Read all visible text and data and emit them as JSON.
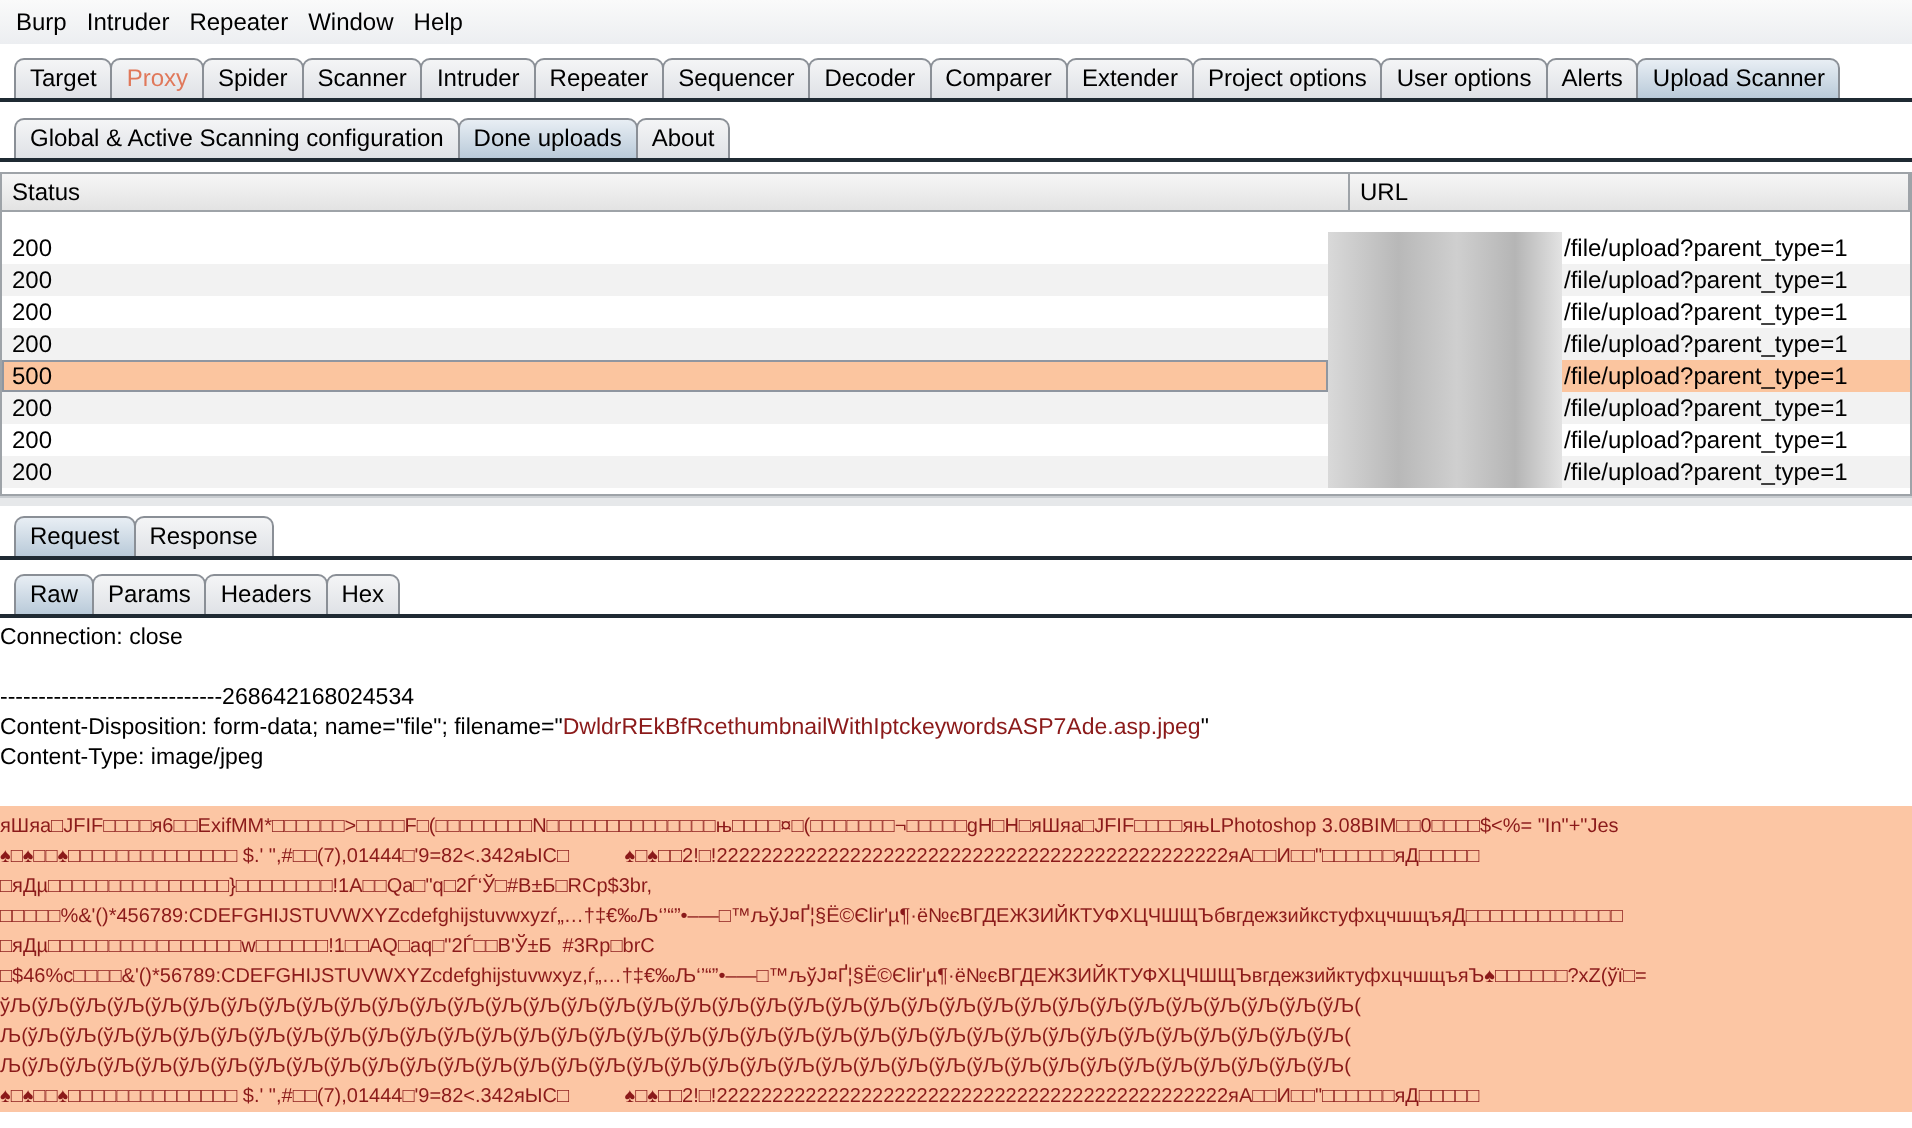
{
  "menu": [
    "Burp",
    "Intruder",
    "Repeater",
    "Window",
    "Help"
  ],
  "main_tabs": [
    {
      "label": "Target",
      "selected": false,
      "highlighted": false
    },
    {
      "label": "Proxy",
      "selected": false,
      "highlighted": true
    },
    {
      "label": "Spider",
      "selected": false,
      "highlighted": false
    },
    {
      "label": "Scanner",
      "selected": false,
      "highlighted": false
    },
    {
      "label": "Intruder",
      "selected": false,
      "highlighted": false
    },
    {
      "label": "Repeater",
      "selected": false,
      "highlighted": false
    },
    {
      "label": "Sequencer",
      "selected": false,
      "highlighted": false
    },
    {
      "label": "Decoder",
      "selected": false,
      "highlighted": false
    },
    {
      "label": "Comparer",
      "selected": false,
      "highlighted": false
    },
    {
      "label": "Extender",
      "selected": false,
      "highlighted": false
    },
    {
      "label": "Project options",
      "selected": false,
      "highlighted": false
    },
    {
      "label": "User options",
      "selected": false,
      "highlighted": false
    },
    {
      "label": "Alerts",
      "selected": false,
      "highlighted": false
    },
    {
      "label": "Upload Scanner",
      "selected": true,
      "highlighted": false
    }
  ],
  "sub_tabs": [
    {
      "label": "Global & Active Scanning configuration",
      "selected": false
    },
    {
      "label": "Done uploads",
      "selected": true
    },
    {
      "label": "About",
      "selected": false
    }
  ],
  "table": {
    "columns": [
      "Status",
      "URL"
    ],
    "rows": [
      {
        "status": "200",
        "url": "/file/upload?parent_type=1",
        "selected": false
      },
      {
        "status": "200",
        "url": "/file/upload?parent_type=1",
        "selected": false
      },
      {
        "status": "200",
        "url": "/file/upload?parent_type=1",
        "selected": false
      },
      {
        "status": "200",
        "url": "/file/upload?parent_type=1",
        "selected": false
      },
      {
        "status": "500",
        "url": "/file/upload?parent_type=1",
        "selected": true
      },
      {
        "status": "200",
        "url": "/file/upload?parent_type=1",
        "selected": false
      },
      {
        "status": "200",
        "url": "/file/upload?parent_type=1",
        "selected": false
      },
      {
        "status": "200",
        "url": "/file/upload?parent_type=1",
        "selected": false
      }
    ]
  },
  "message_tabs": [
    {
      "label": "Request",
      "selected": true
    },
    {
      "label": "Response",
      "selected": false
    }
  ],
  "view_tabs": [
    {
      "label": "Raw",
      "selected": true
    },
    {
      "label": "Params",
      "selected": false
    },
    {
      "label": "Headers",
      "selected": false
    },
    {
      "label": "Hex",
      "selected": false
    }
  ],
  "connection": "Connection: close",
  "boundary": "-----------------------------268642168024534",
  "disposition": {
    "prefix": "Content-Disposition: form-data; name=\"file\"; filename=\"",
    "filename": "DwldrREkBfRcethumbnailWithIptckeywordsASP7Ade.asp.jpeg",
    "suffix": "\""
  },
  "content_type": "Content-Type: image/jpeg",
  "binary_lines": [
    "яШяа□JFIF□□□□я6□□ExifMM*□□□□□□>□□□□F□(□□□□□□□□N□□□□□□□□□□□□□□њ□□□□¤□(□□□□□□□¬□□□□□gH□H□яШяа□JFIF□□□□яњLPhotoshop 3.08BIM□□0□□□□$<%= \"In\"+\"Jes",
    "♠□♠□□♠□□□□□□□□□□□□□□ $.' \",#□□(7),01444□'9=82<.342яЫC□          ♠□♠□□2!□!2222222222222222222222222222222222222222222222яА□□И□□\"□□□□□□яД□□□□□",
    "□яДµ□□□□□□□□□□□□□□□}□□□□□□□□!1A□□Qa□\"q□2Ѓ‘Ў□#B±Б□RCp$3br,",
    "□□□□□%&'()*456789:CDEFGHIJSTUVWXYZcdefghijstuvwxyzѓ„…†‡€‰Љ‘’“”•–—□™љўЈ¤Ґ¦§Ё©Єlir'µ¶·ё№єВГДЕЖЗИЙКТУФХЦЧШЩЪбвгдежзийкстуфхцчшщъяД□□□□□□□□□□□□□",
    "□яДµ□□□□□□□□□□□□□□□□w□□□□□□!1□□AQ□aq□\"2Ѓ□□B'Ў±Б  #3Rp□brC",
    "□$46%c□□□□&'()*56789:CDEFGHIJSTUVWXYZcdefghijstuvwxyz,ѓ„…†‡€‰Љ‘’“”•–—□™љўЈ¤Ґ¦§Ё©Єlir'µ¶·ё№єВГДЕЖЗИЙКТУФХЦЧШЩЪвгдежзийктуфхцчшщъяЪ♠□□□□□□?xZ(ўї□=",
    "ўЉ(ўЉ(ўЉ(ўЉ(ўЉ(ўЉ(ўЉ(ўЉ(ўЉ(ўЉ(ўЉ(ўЉ(ўЉ(ўЉ(ўЉ(ўЉ(ўЉ(ўЉ(ўЉ(ўЉ(ўЉ(ўЉ(ўЉ(ўЉ(ўЉ(ўЉ(ўЉ(ўЉ(ўЉ(ўЉ(ўЉ(ўЉ(ўЉ(ўЉ(ўЉ(ўЉ(",
    "Љ(ўЉ(ўЉ(ўЉ(ўЉ(ўЉ(ўЉ(ўЉ(ўЉ(ўЉ(ўЉ(ўЉ(ўЉ(ўЉ(ўЉ(ўЉ(ўЉ(ўЉ(ўЉ(ўЉ(ўЉ(ўЉ(ўЉ(ўЉ(ўЉ(ўЉ(ўЉ(ўЉ(ўЉ(ўЉ(ўЉ(ўЉ(ўЉ(ўЉ(ўЉ(ўЉ(",
    "Љ(ўЉ(ўЉ(ўЉ(ўЉ(ўЉ(ўЉ(ўЉ(ўЉ(ўЉ(ўЉ(ўЉ(ўЉ(ўЉ(ўЉ(ўЉ(ўЉ(ўЉ(ўЉ(ўЉ(ўЉ(ўЉ(ўЉ(ўЉ(ўЉ(ўЉ(ўЉ(ўЉ(ўЉ(ўЉ(ўЉ(ўЉ(ўЉ(ўЉ(ўЉ(ўЉ(",
    "♠□♠□□♠□□□□□□□□□□□□□□ $.' \",#□□(7),01444□'9=82<.342яЫC□          ♠□♠□□2!□!2222222222222222222222222222222222222222222222яА□□И□□\"□□□□□□яД□□□□□"
  ]
}
